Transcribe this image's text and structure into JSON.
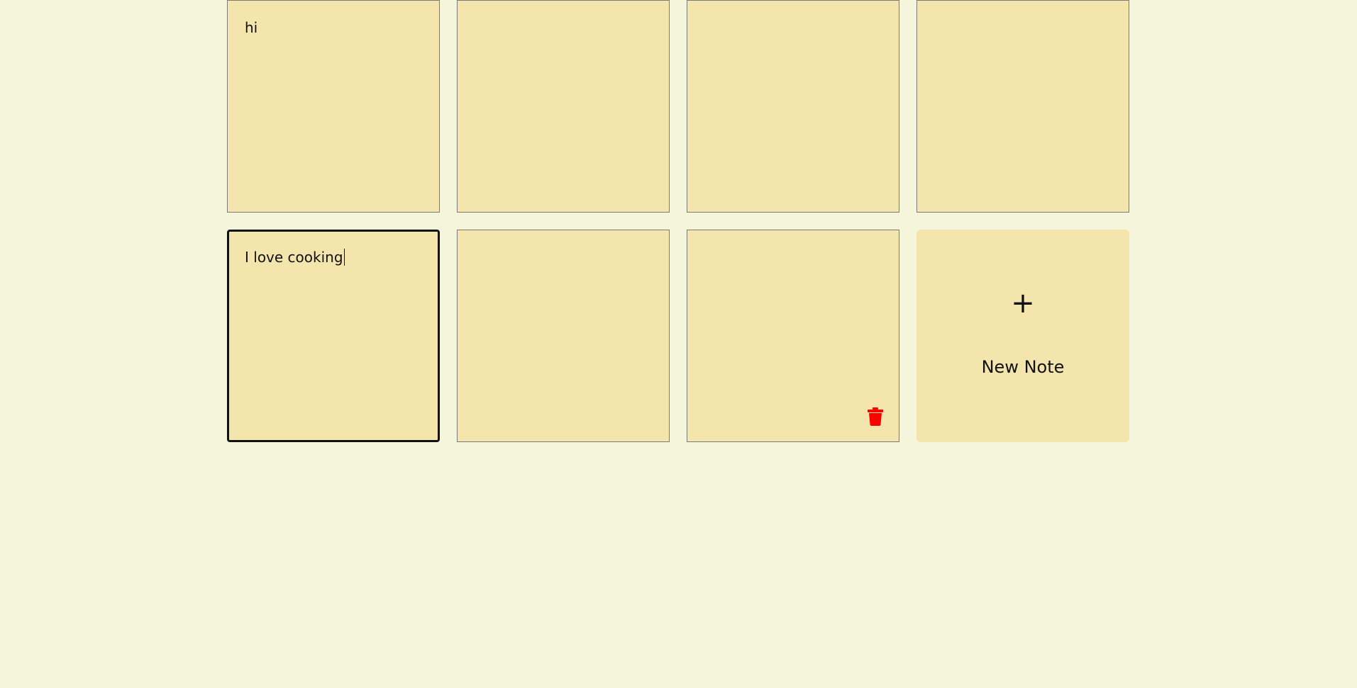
{
  "notes": [
    {
      "text": "hi"
    },
    {
      "text": ""
    },
    {
      "text": ""
    },
    {
      "text": ""
    },
    {
      "text": "I love cooking"
    },
    {
      "text": ""
    },
    {
      "text": ""
    }
  ],
  "new_note": {
    "plus": "+",
    "label": "New Note"
  },
  "colors": {
    "background": "#f5f5dc",
    "note": "#f3e5ab",
    "delete_icon": "#ff0000"
  },
  "icons": {
    "delete": "trash-icon"
  }
}
